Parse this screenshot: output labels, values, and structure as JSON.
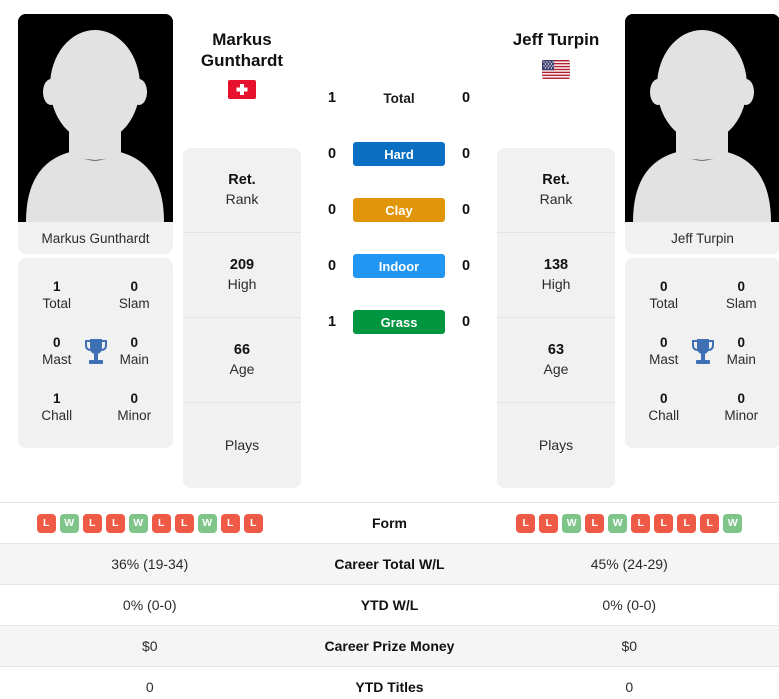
{
  "players": [
    {
      "name": "Markus Gunthardt",
      "name_line1": "Markus",
      "name_line2": "Gunthardt",
      "photo_label": "Markus Gunthardt",
      "country": "Switzerland",
      "flag_icon": "flag-switzerland",
      "rank": {
        "current_value": "Ret.",
        "current_label": "Rank",
        "high_value": "209",
        "high_label": "High",
        "age_value": "66",
        "age_label": "Age",
        "plays_value": "",
        "plays_label": "Plays"
      },
      "titles": {
        "total_value": "1",
        "total_label": "Total",
        "slam_value": "0",
        "slam_label": "Slam",
        "mast_value": "0",
        "mast_label": "Mast",
        "main_value": "0",
        "main_label": "Main",
        "chall_value": "1",
        "chall_label": "Chall",
        "minor_value": "0",
        "minor_label": "Minor"
      },
      "form": [
        "L",
        "W",
        "L",
        "L",
        "W",
        "L",
        "L",
        "W",
        "L",
        "L"
      ],
      "career_total_wl": "36% (19-34)",
      "ytd_wl": "0% (0-0)",
      "career_prize_money": "$0",
      "ytd_titles": "0"
    },
    {
      "name": "Jeff Turpin",
      "name_line1": "Jeff Turpin",
      "name_line2": "",
      "photo_label": "Jeff Turpin",
      "country": "United States",
      "flag_icon": "flag-united-states",
      "rank": {
        "current_value": "Ret.",
        "current_label": "Rank",
        "high_value": "138",
        "high_label": "High",
        "age_value": "63",
        "age_label": "Age",
        "plays_value": "",
        "plays_label": "Plays"
      },
      "titles": {
        "total_value": "0",
        "total_label": "Total",
        "slam_value": "0",
        "slam_label": "Slam",
        "mast_value": "0",
        "mast_label": "Mast",
        "main_value": "0",
        "main_label": "Main",
        "chall_value": "0",
        "chall_label": "Chall",
        "minor_value": "0",
        "minor_label": "Minor"
      },
      "form": [
        "L",
        "L",
        "W",
        "L",
        "W",
        "L",
        "L",
        "L",
        "L",
        "W"
      ],
      "career_total_wl": "45% (24-29)",
      "ytd_wl": "0% (0-0)",
      "career_prize_money": "$0",
      "ytd_titles": "0"
    }
  ],
  "h2h": {
    "total": {
      "label": "Total",
      "left": "1",
      "right": "0"
    },
    "surfaces": [
      {
        "label": "Hard",
        "left": "0",
        "right": "0",
        "color": "#0a6fc2"
      },
      {
        "label": "Clay",
        "left": "0",
        "right": "0",
        "color": "#e09608"
      },
      {
        "label": "Indoor",
        "left": "0",
        "right": "0",
        "color": "#2196f3"
      },
      {
        "label": "Grass",
        "left": "1",
        "right": "0",
        "color": "#009640"
      }
    ]
  },
  "stats_table": {
    "rows": [
      {
        "label": "Form",
        "type": "form"
      },
      {
        "label": "Career Total W/L",
        "type": "text",
        "left": "36% (19-34)",
        "right": "45% (24-29)"
      },
      {
        "label": "YTD W/L",
        "type": "text",
        "left": "0% (0-0)",
        "right": "0% (0-0)"
      },
      {
        "label": "Career Prize Money",
        "type": "text",
        "left": "$0",
        "right": "$0"
      },
      {
        "label": "YTD Titles",
        "type": "text",
        "left": "0",
        "right": "0"
      }
    ]
  },
  "colors": {
    "hard": "#0a6fc2",
    "clay": "#e09608",
    "indoor": "#2196f3",
    "grass": "#009640",
    "win_badge": "#7fc489",
    "loss_badge": "#ef5a46",
    "trophy": "#3f6fb5",
    "panel_bg": "#f1f1f1"
  }
}
